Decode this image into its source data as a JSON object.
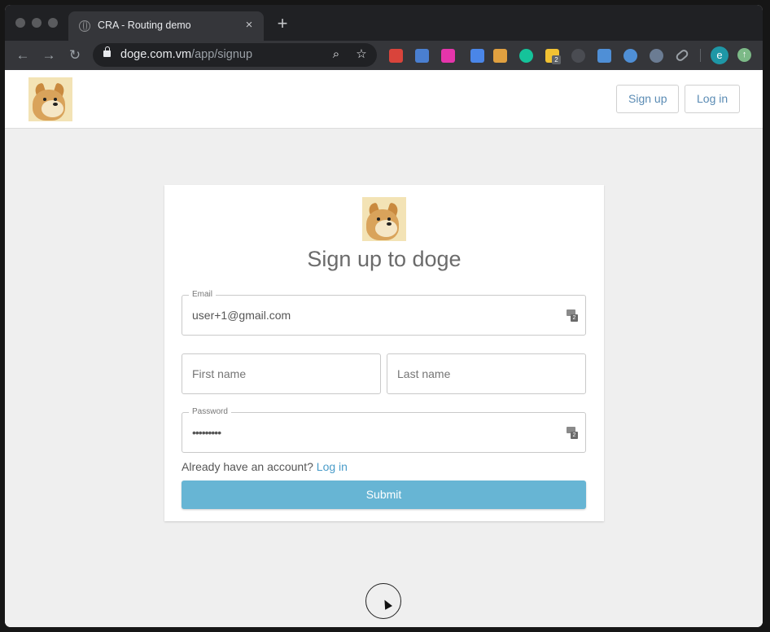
{
  "browser": {
    "tab_title": "CRA - Routing demo",
    "tab_close": "×",
    "new_tab": "+",
    "url_host": "doge.com.vm",
    "url_path": "/app/signup",
    "back_glyph": "←",
    "forward_glyph": "→",
    "reload_glyph": "↻",
    "zoom_glyph": "⌕",
    "bookmark_glyph": "☆",
    "profile_initial": "e",
    "update_glyph": "↑",
    "extension_badge": "2",
    "extensions": [
      {
        "name": "colorzilla-extension-icon",
        "color": "#d9443b"
      },
      {
        "name": "json-viewer-extension-icon",
        "color": "#4a7fd0"
      },
      {
        "name": "graphql-extension-icon",
        "color": "#e535ab"
      },
      {
        "name": "eyedropper-extension-icon",
        "color": "#4a86e8"
      },
      {
        "name": "rainbow-extension-icon",
        "color": "#e0a040"
      },
      {
        "name": "grammarly-extension-icon",
        "color": "#15c39a"
      },
      {
        "name": "notes-extension-icon",
        "color": "#f2c233"
      },
      {
        "name": "react-devtools-extension-icon",
        "color": "#4a4c52"
      },
      {
        "name": "square-extension-icon",
        "color": "#4f8fd6"
      },
      {
        "name": "fps-extension-icon",
        "color": "#4f8fd6"
      },
      {
        "name": "globe-extension-icon",
        "color": "#6b7c93"
      },
      {
        "name": "link-extension-icon",
        "color": "#9aa0a6"
      }
    ]
  },
  "header": {
    "signup_label": "Sign up",
    "login_label": "Log in"
  },
  "form": {
    "title": "Sign up to doge",
    "email_label": "Email",
    "email_value": "user+1@gmail.com",
    "first_name_placeholder": "First name",
    "last_name_placeholder": "Last name",
    "password_label": "Password",
    "password_value": "•••••••••",
    "already_text": "Already have an account?",
    "login_link": "Log in",
    "submit_label": "Submit",
    "manager_badge": "2"
  },
  "colors": {
    "accent": "#67b5d4",
    "link": "#4a9cc9"
  }
}
